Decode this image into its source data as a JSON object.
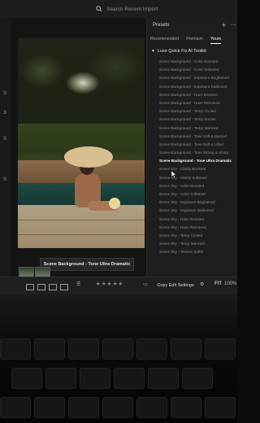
{
  "search": {
    "placeholder": "Search Recent Import"
  },
  "left_strip": {
    "marks": [
      "S",
      "3",
      "S",
      "S"
    ]
  },
  "panel": {
    "title": "Presets",
    "tabs": [
      {
        "label": "Recommended",
        "active": false
      },
      {
        "label": "Premium",
        "active": false
      },
      {
        "label": "Yours",
        "active": true
      }
    ],
    "group_title": "Luxe Quick Fix AI Toolkit",
    "items": [
      "Scene Background - Color Boosted",
      "Scene Background - Color Softened",
      "Scene Background - Exposure Brightened",
      "Scene Background - Exposure Darkened",
      "Scene Background - Haze Boosted",
      "Scene Background - Haze Removed",
      "Scene Background - Temp Cooled",
      "Scene Background - Temp Sunset",
      "Scene Background - Temp Warmed",
      "Scene Background - Tone Soft & Blurred",
      "Scene Background - Tone Soft & Lifted",
      "Scene Background - Tone Strong & Sharp",
      "Scene Background - Tone Ultra Dramatic",
      "Scene Sky - Clarity Boosted",
      "Scene Sky - Clarity Softened",
      "Scene Sky - Color Boosted",
      "Scene Sky - Color Softened",
      "Scene Sky - Exposure Brightened",
      "Scene Sky - Exposure Darkened",
      "Scene Sky - Haze Boosted",
      "Scene Sky - Haze Removed",
      "Scene Sky - Temp Cooled",
      "Scene Sky - Temp Warmed",
      "Scene Sky - Texture Softer"
    ],
    "selected_index": 12
  },
  "canvas": {
    "caption": "Scene Background - Tone Ultra Dramatic"
  },
  "bottom": {
    "stars": "★★★★★",
    "copy_label": "Copy Edit Settings",
    "fit_label": "FIT",
    "zoom_label": "100%"
  },
  "colors": {
    "panel_bg": "#1e1e1f",
    "selected_text": "#ffffff",
    "dim_text": "#8c8c8c"
  }
}
